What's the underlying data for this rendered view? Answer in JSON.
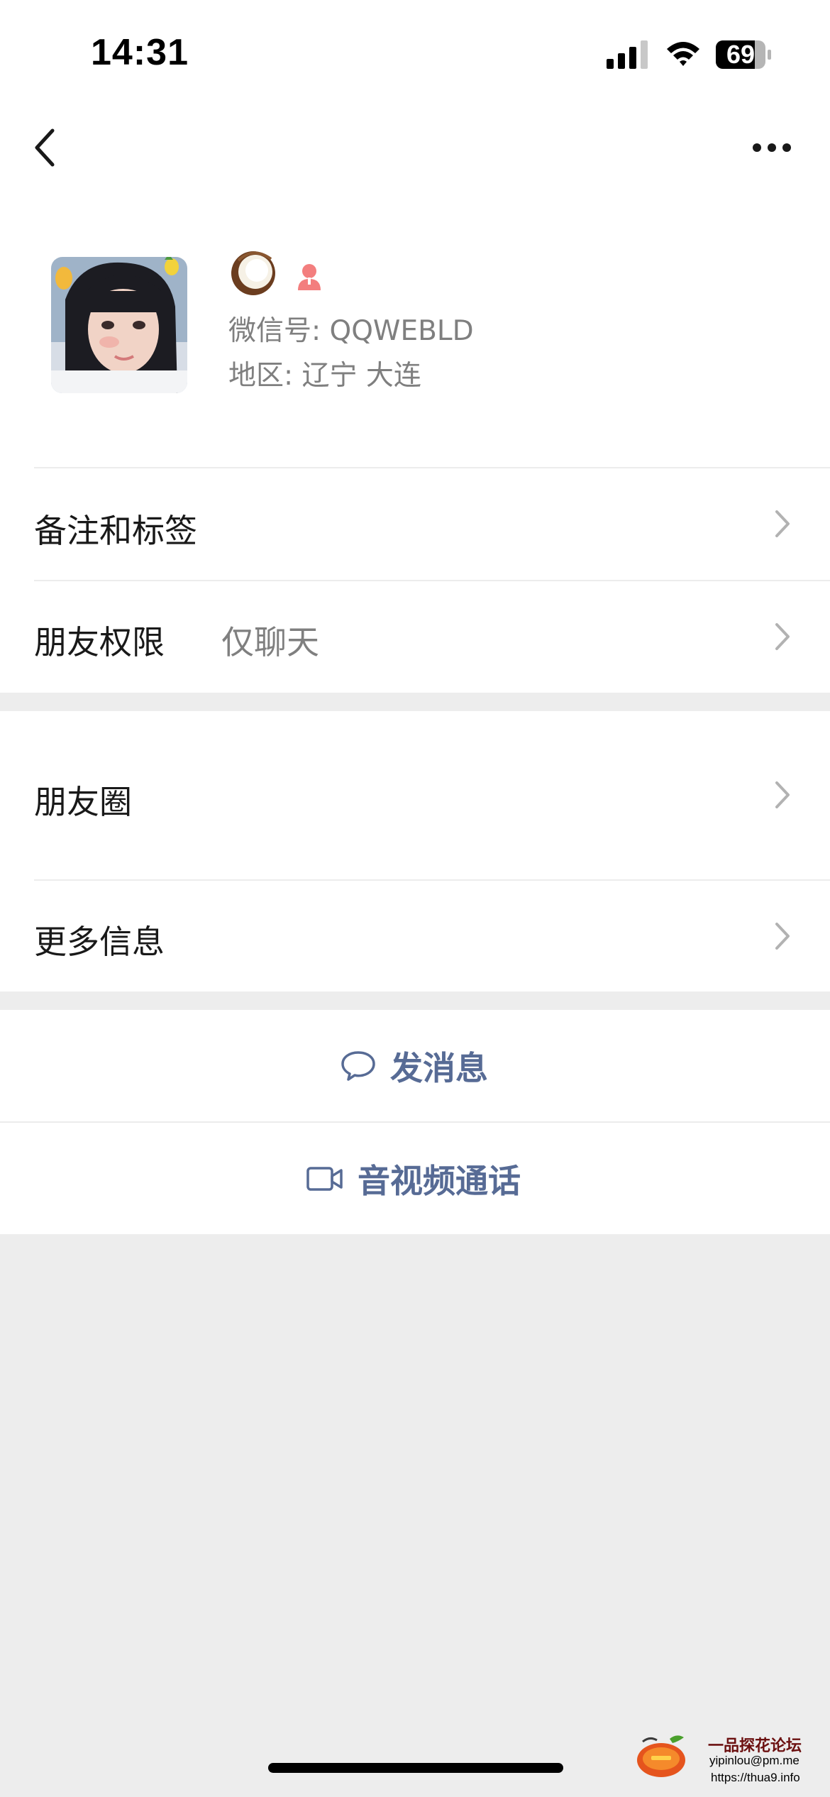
{
  "status_bar": {
    "time": "14:31",
    "battery": "69",
    "icons": [
      "cellular-signal-icon",
      "wifi-icon",
      "battery-icon"
    ]
  },
  "nav": {
    "back_icon": "chevron-left-icon",
    "more_icon": "ellipsis-icon"
  },
  "profile": {
    "name_icon": "coconut-emoji",
    "gender_icon": "female-icon",
    "wechat_id": "微信号: QQWEBLD",
    "region": "地区: 辽宁 大连"
  },
  "list": {
    "remarks_label": "备注和标签",
    "permissions_label": "朋友权限",
    "permissions_value": "仅聊天",
    "moments_label": "朋友圈",
    "more_info_label": "更多信息"
  },
  "actions": {
    "message_label": "发消息",
    "message_icon": "chat-bubble-icon",
    "call_label": "音视频通话",
    "call_icon": "video-camera-icon"
  },
  "watermark": {
    "title": "一品探花论坛",
    "email": "yipinlou@pm.me",
    "url": "https://thua9.info"
  },
  "colors": {
    "accent_link": "#576b95",
    "background": "#ededed",
    "card": "#ffffff",
    "secondary_text": "#7f7f7f",
    "female_icon": "#f37e7e"
  }
}
